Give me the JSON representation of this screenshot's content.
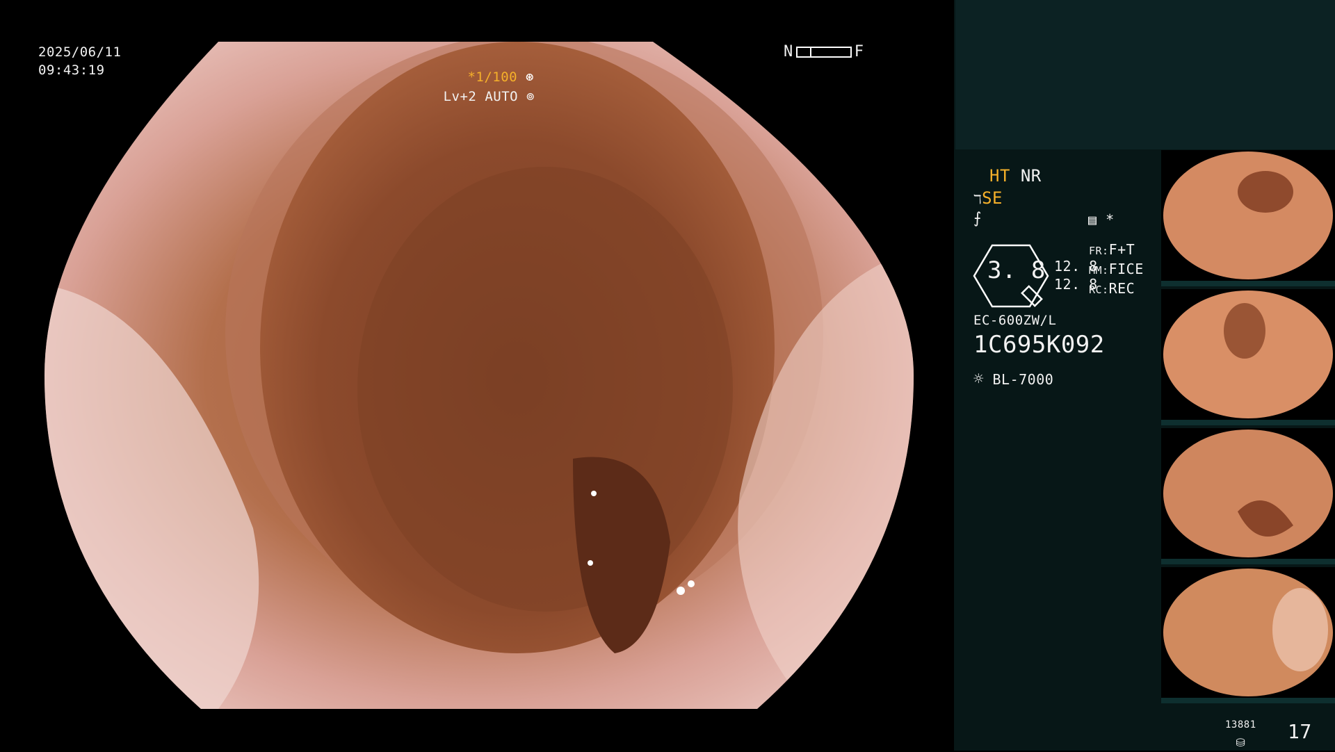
{
  "overlay": {
    "date": "2025/06/11",
    "time": "09:43:19",
    "nf_near": "N",
    "nf_far": "F",
    "shutter": "*1/100",
    "shutter_icon": "aperture-icon",
    "level": "Lv+2",
    "mode": "AUTO",
    "mode_icon": "iris-icon"
  },
  "panel": {
    "ht": "HT",
    "nr": "NR",
    "se": "SE",
    "enhance_icon": "enhance-icon",
    "edge_icon": "edge-icon",
    "star": "*",
    "zoom": "3. 8",
    "val1": "12. 8",
    "val2": "12. 8",
    "fr_label": "FR:",
    "fr_value": "F+T",
    "mm_label": "MM:",
    "mm_value": "FICE",
    "rc_label": "RC:",
    "rc_value": "REC",
    "scope_model": "EC-600ZW/L",
    "scope_serial": "1C695K092",
    "light_source": "BL-7000",
    "light_icon": "lamp-icon",
    "counter": "13881",
    "frame_count": "17"
  },
  "colors": {
    "accent": "#f5b02a",
    "panel_bg": "#071717",
    "panel_top": "#0c2223"
  }
}
